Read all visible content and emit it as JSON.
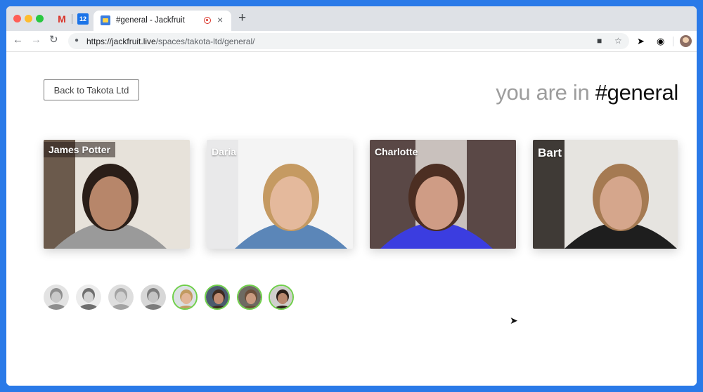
{
  "browser": {
    "pinned_tabs": [
      {
        "icon": "gmail-icon",
        "glyph": "M"
      },
      {
        "icon": "calendar-icon",
        "glyph": "12"
      }
    ],
    "active_tab": {
      "title": "#general - Jackfruit",
      "close_glyph": "×"
    },
    "new_tab_glyph": "+",
    "url": {
      "host": "https://jackfruit.live",
      "path": "/spaces/takota-ltd/general/"
    }
  },
  "page": {
    "back_button": "Back to Takota Ltd",
    "heading_prefix": "you are in",
    "heading_room": "#general"
  },
  "participants": [
    {
      "name": "James Potter",
      "bg": "#6b5a4c",
      "wall": "#e7e2da",
      "skin": "#b7866a",
      "hair": "#2a1e18",
      "shirt": "#9a9a9a"
    },
    {
      "name": "Daria",
      "bg": "#e9e9ea",
      "wall": "#f4f4f4",
      "skin": "#e4b99c",
      "hair": "#c59a62",
      "shirt": "#5b86b8"
    },
    {
      "name": "Charlotte",
      "bg": "#5a4846",
      "wall": "#c9c1bd",
      "skin": "#cf9c85",
      "hair": "#4c2e22",
      "shirt": "#3b3de0"
    },
    {
      "name": "Bart",
      "bg": "#3f3a36",
      "wall": "#e6e4e0",
      "skin": "#d5a68c",
      "hair": "#a57a52",
      "shirt": "#1e1e1e"
    }
  ],
  "avatars": [
    {
      "active": false,
      "skin": "#c9c9c9",
      "hair": "#8e8e8e",
      "bg": "#e3e3e3"
    },
    {
      "active": false,
      "skin": "#d2d2d2",
      "hair": "#6f6f6f",
      "bg": "#ececec"
    },
    {
      "active": false,
      "skin": "#cfcfcf",
      "hair": "#a3a3a3",
      "bg": "#dedede"
    },
    {
      "active": false,
      "skin": "#c4c4c4",
      "hair": "#7c7c7c",
      "bg": "#d7d7d7"
    },
    {
      "active": true,
      "skin": "#e2b597",
      "hair": "#c29a60",
      "bg": "#dbe0e4"
    },
    {
      "active": true,
      "skin": "#c28c72",
      "hair": "#3d2a20",
      "bg": "#4a5a6e"
    },
    {
      "active": true,
      "skin": "#c99a80",
      "hair": "#6a4e3a",
      "bg": "#6e6a62"
    },
    {
      "active": true,
      "skin": "#b8876d",
      "hair": "#2a1e18",
      "bg": "#d0cfcd"
    }
  ]
}
